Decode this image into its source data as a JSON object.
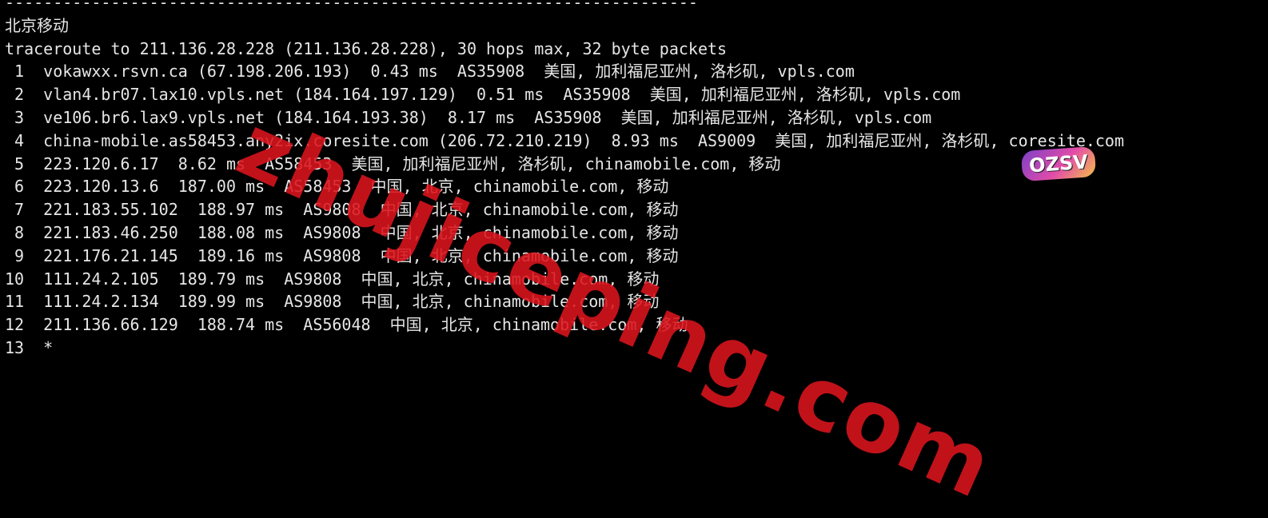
{
  "terminal": {
    "lines": [
      "------------------------------------------------------------------------",
      "北京移动",
      "traceroute to 211.136.28.228 (211.136.28.228), 30 hops max, 32 byte packets",
      " 1  vokawxx.rsvn.ca (67.198.206.193)  0.43 ms  AS35908  美国, 加利福尼亚州, 洛杉矶, vpls.com",
      " 2  vlan4.br07.lax10.vpls.net (184.164.197.129)  0.51 ms  AS35908  美国, 加利福尼亚州, 洛杉矶, vpls.com",
      " 3  ve106.br6.lax9.vpls.net (184.164.193.38)  8.17 ms  AS35908  美国, 加利福尼亚州, 洛杉矶, vpls.com",
      " 4  china-mobile.as58453.any2ix.coresite.com (206.72.210.219)  8.93 ms  AS9009  美国, 加利福尼亚州, 洛杉矶, coresite.com",
      " 5  223.120.6.17  8.62 ms  AS58453  美国, 加利福尼亚州, 洛杉矶, chinamobile.com, 移动",
      " 6  223.120.13.6  187.00 ms  AS58453  中国, 北京, chinamobile.com, 移动",
      " 7  221.183.55.102  188.97 ms  AS9808  中国, 北京, chinamobile.com, 移动",
      " 8  221.183.46.250  188.08 ms  AS9808  中国, 北京, chinamobile.com, 移动",
      " 9  221.176.21.145  189.16 ms  AS9808  中国, 北京, chinamobile.com, 移动",
      "10  111.24.2.105  189.79 ms  AS9808  中国, 北京, chinamobile.com, 移动",
      "11  111.24.2.134  189.99 ms  AS9808  中国, 北京, chinamobile.com, 移动",
      "12  211.136.66.129  188.74 ms  AS56048  中国, 北京, chinamobile.com, 移动",
      "13  *"
    ]
  },
  "watermark": {
    "text": "zhujiceping.com",
    "color": "#dc141e"
  },
  "badge": {
    "text": "OZSV"
  }
}
